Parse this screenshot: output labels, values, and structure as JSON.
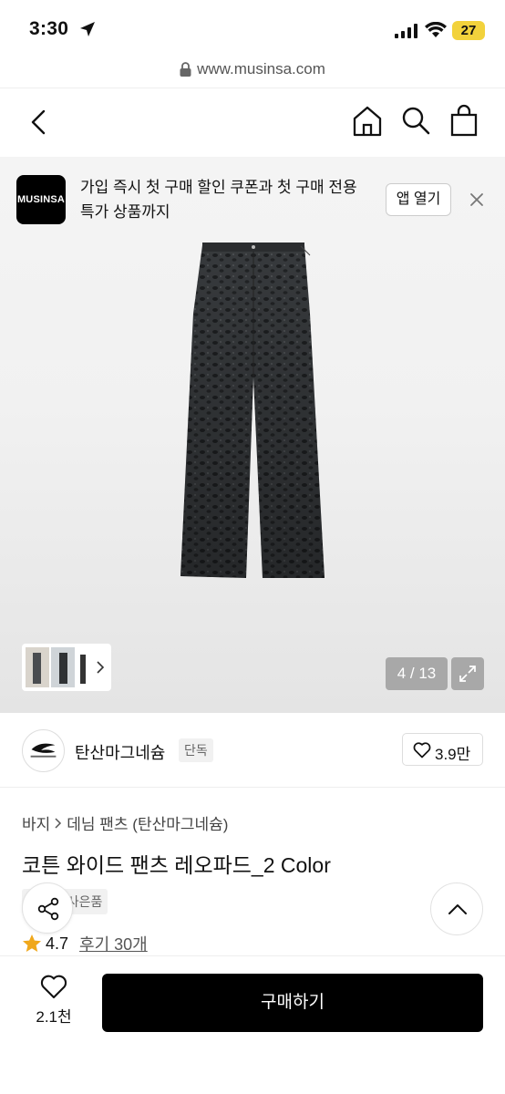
{
  "status_bar": {
    "time": "3:30",
    "battery": "27",
    "battery_color": "#f2d23c"
  },
  "url_bar": {
    "url": "www.musinsa.com"
  },
  "nav": {
    "icons": [
      "back-icon",
      "home-icon",
      "search-icon",
      "bag-icon"
    ]
  },
  "promo": {
    "logo_text": "MUSINSA",
    "message": "가입 즉시 첫 구매 할인 쿠폰과 첫 구매 전용 특가 상품까지",
    "app_button": "앱 열기"
  },
  "gallery": {
    "counter": "4 / 13",
    "current": 4,
    "total": 13
  },
  "brand": {
    "name": "탄산마그네슘",
    "badge": "단독",
    "likes": "3.9만"
  },
  "product": {
    "breadcrumb": [
      "바지",
      "데님 팬츠 (탄산마그네슘)"
    ],
    "title": "코튼 와이드 팬츠 레오파드_2 Color",
    "tags": [
      "단독",
      "사은품"
    ],
    "rating": "4.7",
    "reviews": "후기 30개"
  },
  "bottom_bar": {
    "wish_count": "2.1천",
    "buy_label": "구매하기"
  },
  "colors": {
    "primary": "#000000",
    "star": "#f0a81c",
    "gallery_badge": "#a8a8a8"
  }
}
